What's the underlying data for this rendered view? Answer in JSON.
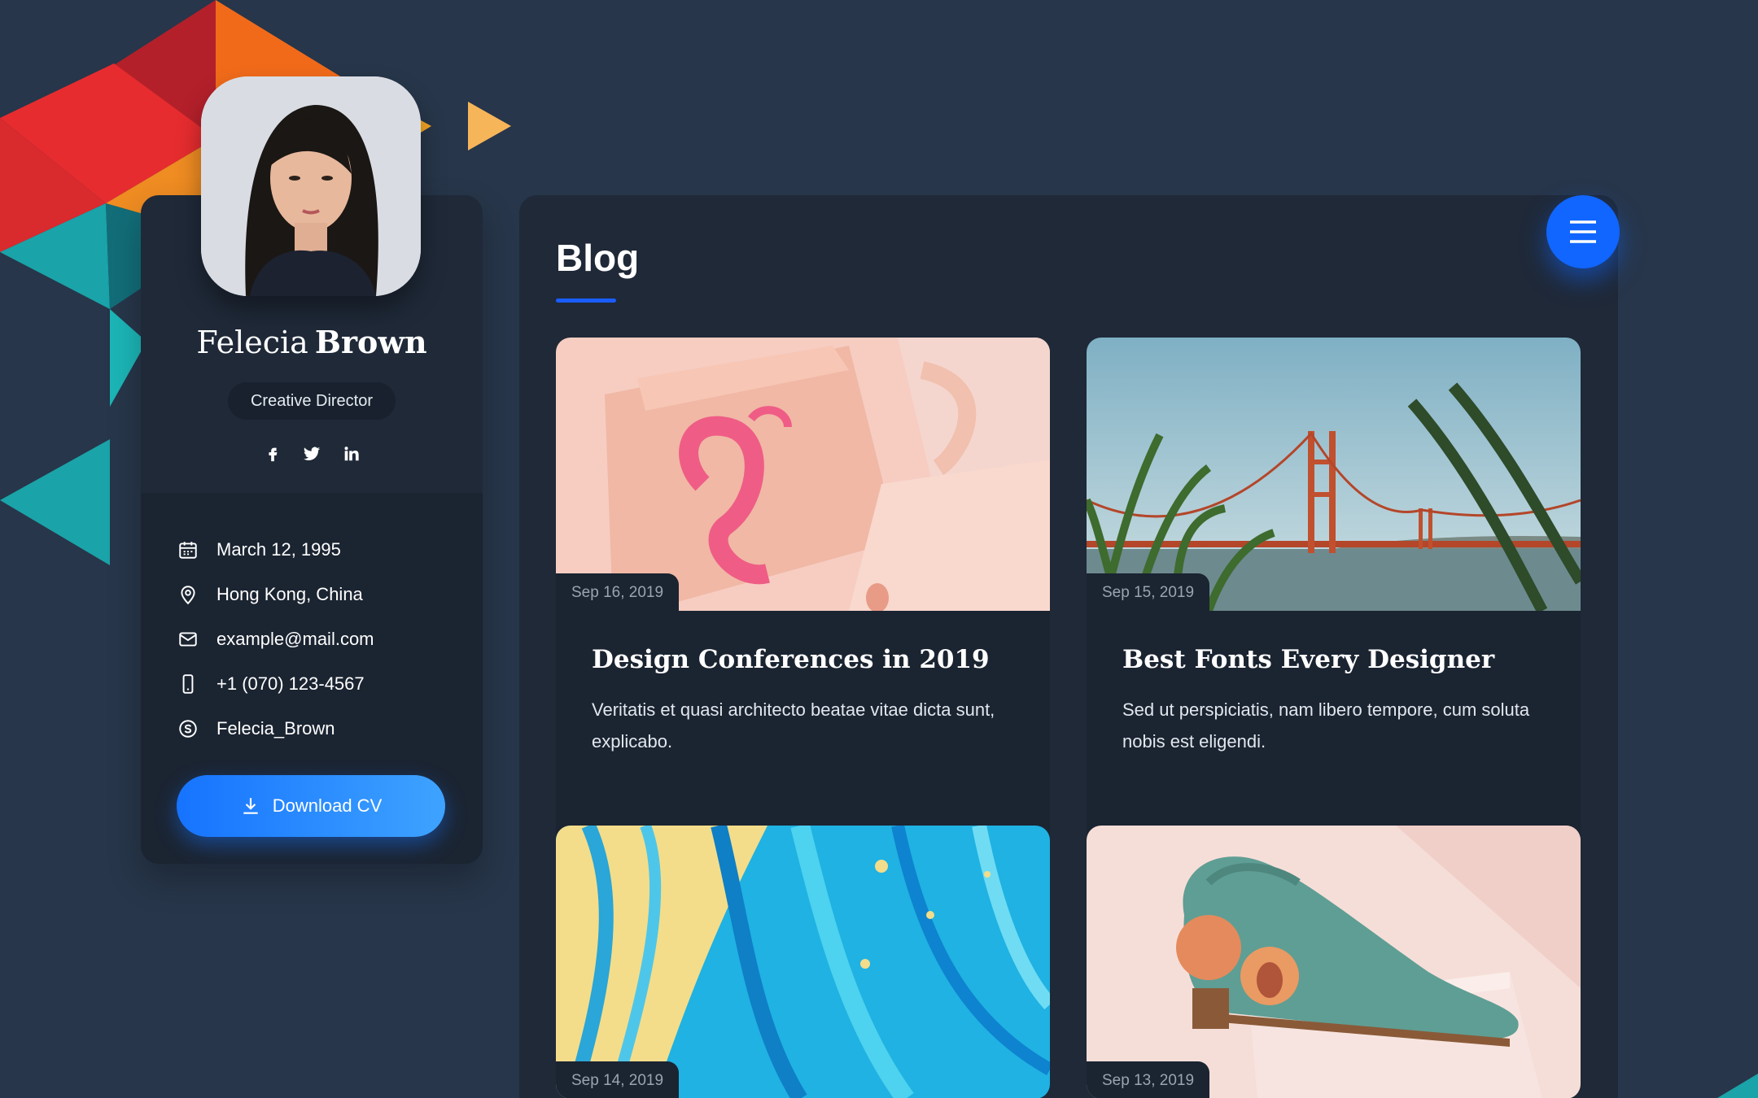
{
  "profile": {
    "first_name": "Felecia",
    "last_name": "Brown",
    "role": "Creative Director",
    "socials": [
      "facebook-icon",
      "twitter-icon",
      "linkedin-icon"
    ],
    "info": [
      {
        "icon": "calendar-icon",
        "text": "March 12, 1995"
      },
      {
        "icon": "location-pin-icon",
        "text": "Hong Kong, China"
      },
      {
        "icon": "mail-icon",
        "text": "example@mail.com"
      },
      {
        "icon": "phone-icon",
        "text": "+1 (070) 123-4567"
      },
      {
        "icon": "skype-icon",
        "text": "Felecia_Brown"
      }
    ],
    "download_label": "Download CV"
  },
  "blog": {
    "title": "Blog",
    "posts": [
      {
        "date": "Sep 16, 2019",
        "title": "Design Conferences in 2019",
        "excerpt": "Veritatis et quasi architecto beatae vitae dicta sunt, explicabo."
      },
      {
        "date": "Sep 15, 2019",
        "title": "Best Fonts Every Designer",
        "excerpt": "Sed ut perspiciatis, nam libero tempore, cum soluta nobis est eligendi."
      },
      {
        "date": "Sep 14, 2019",
        "title": "",
        "excerpt": ""
      },
      {
        "date": "Sep 13, 2019",
        "title": "",
        "excerpt": ""
      }
    ]
  },
  "colors": {
    "page_bg": "#27364a",
    "card_bg": "#1f2938",
    "accent": "#1066ff",
    "muted_text": "#9aa4b2"
  }
}
